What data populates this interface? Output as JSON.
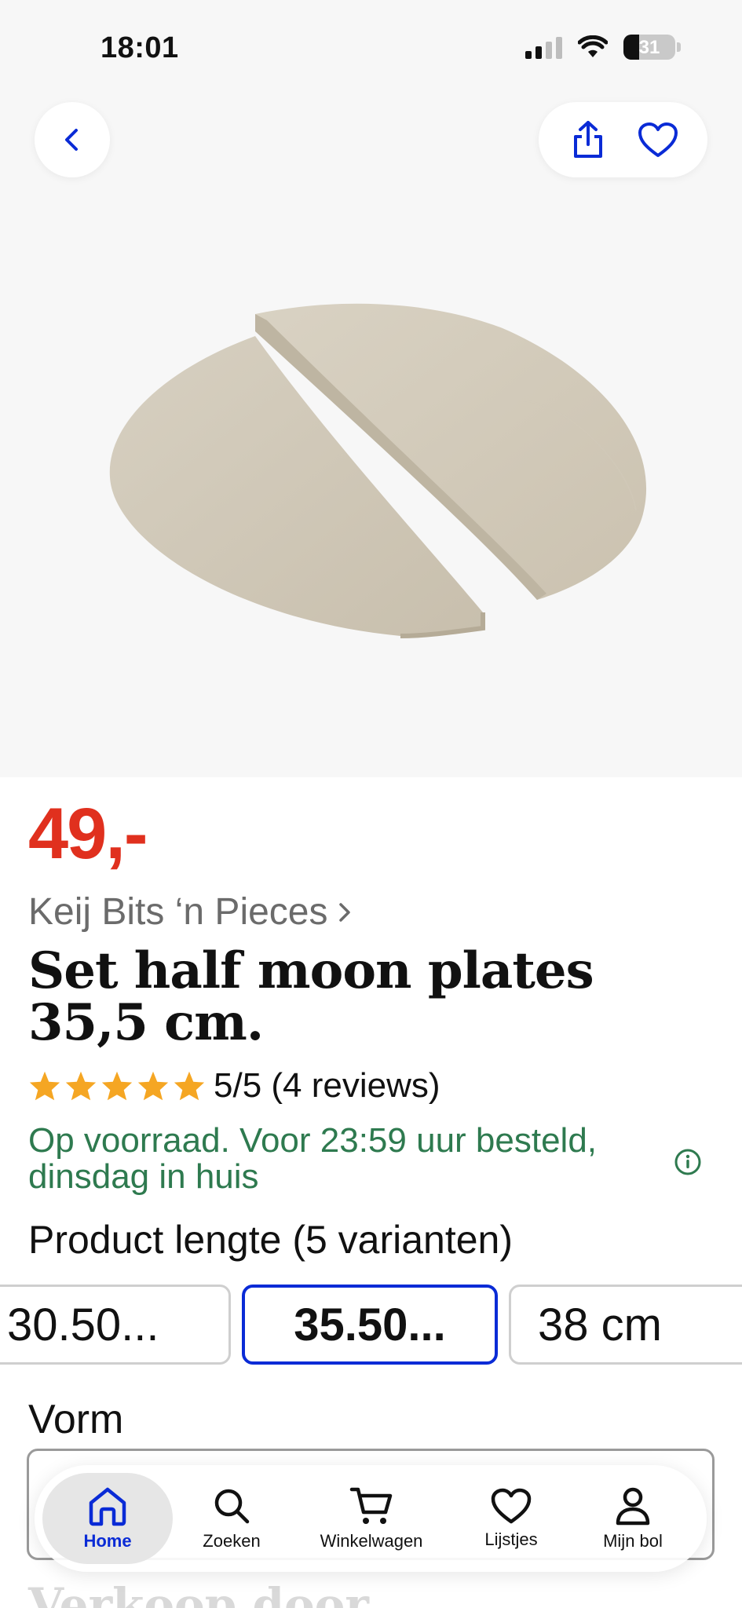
{
  "status_bar": {
    "time": "18:01",
    "battery": "31",
    "icons": [
      "signal-icon",
      "wifi-icon",
      "battery-icon"
    ]
  },
  "header": {
    "back_icon": "chevron-left-icon",
    "share_icon": "share-icon",
    "favorite_icon": "heart-icon"
  },
  "product": {
    "price": "49,-",
    "brand": "Keij Bits ‘n Pieces",
    "title": "Set half moon plates 35,5 cm.",
    "rating_value": 5,
    "rating_text": "5/5 (4 reviews)",
    "stock_text": "Op voorraad. Voor 23:59 uur besteld, dinsdag in huis",
    "variant_label": "Product lengte (5 varianten)",
    "variants": [
      {
        "label": "30.50...",
        "selected": false
      },
      {
        "label": "35.50...",
        "selected": true
      },
      {
        "label": "38 cm",
        "selected": false
      }
    ],
    "vorm_label": "Vorm",
    "section_peek": "Verkoop door"
  },
  "tabbar": {
    "items": [
      {
        "label": "Home",
        "icon": "home-icon",
        "active": true
      },
      {
        "label": "Zoeken",
        "icon": "search-icon",
        "active": false
      },
      {
        "label": "Winkelwagen",
        "icon": "cart-icon",
        "active": false
      },
      {
        "label": "Lijstjes",
        "icon": "heart-icon",
        "active": false
      },
      {
        "label": "Mijn bol",
        "icon": "user-icon",
        "active": false
      }
    ]
  },
  "colors": {
    "price": "#e0301e",
    "stock": "#2e7a4f",
    "accent": "#0a2bd6",
    "star": "#f5a623"
  }
}
